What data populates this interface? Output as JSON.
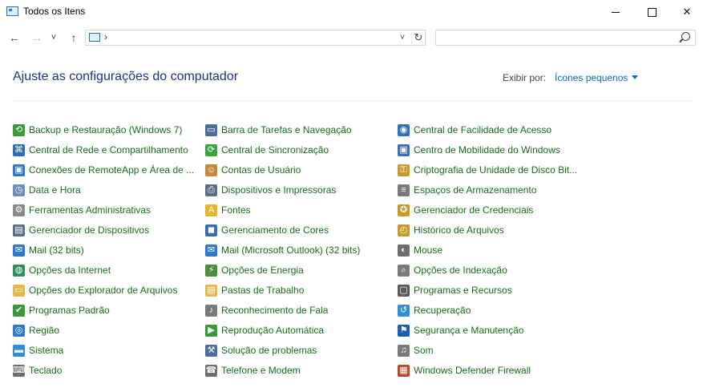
{
  "window": {
    "title": "Todos os Itens",
    "controls": {
      "minimize": "—",
      "maximize": "☐",
      "close": "✕"
    }
  },
  "nav": {
    "back": "←",
    "forward": "→",
    "recent": "˅",
    "up": "↑",
    "address_chevron": "›",
    "address_dropdown": "˅",
    "refresh": "↻",
    "search_value": "",
    "search_placeholder": ""
  },
  "header": {
    "title": "Ajuste as configurações do computador",
    "viewby_label": "Exibir por:",
    "viewby_value": "Ícones pequenos"
  },
  "colors": {
    "title": "#1e3287",
    "item_text": "#1a6b1a",
    "link": "#0b66c2"
  },
  "items": [
    {
      "label": "Backup e Restauração (Windows 7)",
      "icon": "backup-icon",
      "glyph": "⟲",
      "color": "#3a9a3a"
    },
    {
      "label": "Central de Rede e Compartilhamento",
      "icon": "network-icon",
      "glyph": "⌘",
      "color": "#2a6fb5"
    },
    {
      "label": "Conexões de RemoteApp e Área de ...",
      "icon": "remoteapp-icon",
      "glyph": "▣",
      "color": "#2f79c9"
    },
    {
      "label": "Data e Hora",
      "icon": "calendar-clock-icon",
      "glyph": "◷",
      "color": "#6c8fb5"
    },
    {
      "label": "Ferramentas Administrativas",
      "icon": "admin-tools-icon",
      "glyph": "⚙",
      "color": "#8a8a8a"
    },
    {
      "label": "Gerenciador de Dispositivos",
      "icon": "device-manager-icon",
      "glyph": "▤",
      "color": "#5a6e86"
    },
    {
      "label": "Mail (32 bits)",
      "icon": "mail-icon",
      "glyph": "✉",
      "color": "#2f79c9"
    },
    {
      "label": "Opções da Internet",
      "icon": "internet-options-icon",
      "glyph": "◍",
      "color": "#2e8f5c"
    },
    {
      "label": "Opções do Explorador de Arquivos",
      "icon": "folder-options-icon",
      "glyph": "▭",
      "color": "#e5b84a"
    },
    {
      "label": "Programas Padrão",
      "icon": "default-programs-icon",
      "glyph": "✔",
      "color": "#3a9a3a"
    },
    {
      "label": "Região",
      "icon": "region-icon",
      "glyph": "◎",
      "color": "#2f79c9"
    },
    {
      "label": "Sistema",
      "icon": "system-icon",
      "glyph": "▬",
      "color": "#2f8fd6"
    },
    {
      "label": "Teclado",
      "icon": "keyboard-icon",
      "glyph": "⌨",
      "color": "#6e6e6e"
    },
    {
      "label": "Barra de Tarefas e Navegação",
      "icon": "taskbar-icon",
      "glyph": "▭",
      "color": "#4a6f9a"
    },
    {
      "label": "Central de Sincronização",
      "icon": "sync-center-icon",
      "glyph": "⟳",
      "color": "#3aa53a"
    },
    {
      "label": "Contas de Usuário",
      "icon": "user-accounts-icon",
      "glyph": "☺",
      "color": "#c48a3a"
    },
    {
      "label": "Dispositivos e Impressoras",
      "icon": "printer-icon",
      "glyph": "⎙",
      "color": "#5a6e86"
    },
    {
      "label": "Fontes",
      "icon": "fonts-icon",
      "glyph": "A",
      "color": "#e3b52e"
    },
    {
      "label": "Gerenciamento de Cores",
      "icon": "color-management-icon",
      "glyph": "◼",
      "color": "#3b6db3"
    },
    {
      "label": "Mail (Microsoft Outlook) (32 bits)",
      "icon": "outlook-mail-icon",
      "glyph": "✉",
      "color": "#2f79c9"
    },
    {
      "label": "Opções de Energia",
      "icon": "power-options-icon",
      "glyph": "⚡",
      "color": "#4b8f3a"
    },
    {
      "label": "Pastas de Trabalho",
      "icon": "work-folders-icon",
      "glyph": "▤",
      "color": "#e5b84a"
    },
    {
      "label": "Reconhecimento de Fala",
      "icon": "microphone-icon",
      "glyph": "♪",
      "color": "#7a7a7a"
    },
    {
      "label": "Reprodução Automática",
      "icon": "autoplay-icon",
      "glyph": "▶",
      "color": "#3a9a3a"
    },
    {
      "label": "Solução de problemas",
      "icon": "troubleshoot-icon",
      "glyph": "⚒",
      "color": "#4a6f9a"
    },
    {
      "label": "Telefone e Modem",
      "icon": "phone-modem-icon",
      "glyph": "☎",
      "color": "#6e6e6e"
    },
    {
      "label": "Central de Facilidade de Acesso",
      "icon": "ease-of-access-icon",
      "glyph": "◉",
      "color": "#2f6fbf"
    },
    {
      "label": "Centro de Mobilidade do Windows",
      "icon": "mobility-center-icon",
      "glyph": "▣",
      "color": "#3b6db3"
    },
    {
      "label": "Criptografia de Unidade de Disco Bit...",
      "icon": "bitlocker-icon",
      "glyph": "⚿",
      "color": "#c69a2e"
    },
    {
      "label": "Espaços de Armazenamento",
      "icon": "storage-spaces-icon",
      "glyph": "≡",
      "color": "#7a7a7a"
    },
    {
      "label": "Gerenciador de Credenciais",
      "icon": "credential-manager-icon",
      "glyph": "✪",
      "color": "#c69a2e"
    },
    {
      "label": "Histórico de Arquivos",
      "icon": "file-history-icon",
      "glyph": "◴",
      "color": "#c69a2e"
    },
    {
      "label": "Mouse",
      "icon": "mouse-icon",
      "glyph": "◐",
      "color": "#6e6e6e"
    },
    {
      "label": "Opções de Indexação",
      "icon": "indexing-icon",
      "glyph": "⌕",
      "color": "#7a7a7a"
    },
    {
      "label": "Programas e Recursos",
      "icon": "programs-features-icon",
      "glyph": "▢",
      "color": "#5a5a5a"
    },
    {
      "label": "Recuperação",
      "icon": "recovery-icon",
      "glyph": "↺",
      "color": "#2f8fd6"
    },
    {
      "label": "Segurança e Manutenção",
      "icon": "security-maintenance-icon",
      "glyph": "⚑",
      "color": "#1b5fb5"
    },
    {
      "label": "Som",
      "icon": "sound-icon",
      "glyph": "♫",
      "color": "#7a7a7a"
    },
    {
      "label": "Windows Defender Firewall",
      "icon": "firewall-icon",
      "glyph": "▦",
      "color": "#b54a2e"
    }
  ]
}
